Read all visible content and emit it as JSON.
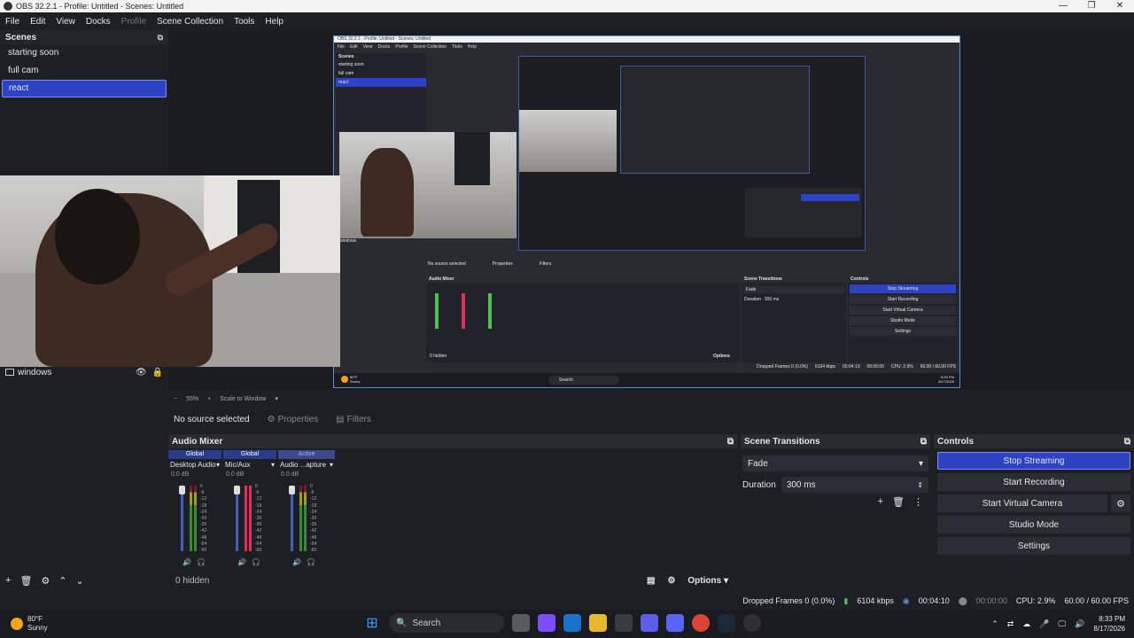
{
  "window": {
    "title": "OBS 32.2.1 - Profile: Untitled - Scenes: Untitled",
    "controls": [
      "—",
      "❐",
      "✕"
    ]
  },
  "menu": {
    "items": [
      "File",
      "Edit",
      "View",
      "Docks",
      "Profile",
      "Scene Collection",
      "Tools",
      "Help"
    ]
  },
  "scenes": {
    "title": "Scenes",
    "items": [
      "starting soon",
      "full cam",
      "react"
    ],
    "selected": "react"
  },
  "sources": {
    "item": "windows"
  },
  "preview": {
    "zoom": "55%",
    "scale": "Scale to Window",
    "nested": {
      "title": "OBS 32.2.1 - Profile: Untitled - Scenes: Untitled",
      "menu": [
        "File",
        "Edit",
        "View",
        "Docks",
        "Profile",
        "Scene Collection",
        "Tools",
        "Help"
      ],
      "scenes_title": "Scenes",
      "scenes": [
        "starting soon",
        "full cam",
        "react"
      ],
      "source": "windows",
      "no_source": "No source selected",
      "properties": "Properties",
      "filters": "Filters",
      "mixer_title": "Audio Mixer",
      "transitions_title": "Scene Transitions",
      "controls_title": "Controls",
      "fade": "Fade",
      "duration": "Duration",
      "duration_val": "300 ms",
      "btns": [
        "Stop Streaming",
        "Start Recording",
        "Start Virtual Camera",
        "Studio Mode",
        "Settings"
      ],
      "hidden": "0 hidden",
      "options": "Options",
      "status": "Dropped Frames 0 (0.0%)",
      "kbps": "6104 kbps",
      "time1": "00:04:10",
      "time2": "00:00:00",
      "cpu": "CPU: 2.9%",
      "fps": "60.00 / 60.00 FPS",
      "weather_temp": "80°F",
      "weather_desc": "Sunny",
      "search": "Search",
      "clock_time": "8:33 PM",
      "clock_date": "8/17/2026"
    }
  },
  "properties_bar": {
    "no_source": "No source selected",
    "properties": "Properties",
    "filters": "Filters"
  },
  "mixer": {
    "title": "Audio Mixer",
    "channels": [
      {
        "badge": "Global",
        "name": "Desktop Audio",
        "db": "0.0 dB",
        "color": "#4ec24e"
      },
      {
        "badge": "Global",
        "name": "Mic/Aux",
        "db": "0.0 dB",
        "color": "#e0305a"
      },
      {
        "badge": "Active",
        "name": "Audio ...apture",
        "db": "0.0 dB",
        "color": "#4ec24e"
      }
    ],
    "scale": [
      "0",
      "-6",
      "-12",
      "-18",
      "-24",
      "-30",
      "-36",
      "-42",
      "-48",
      "-54",
      "-60"
    ],
    "hidden": "0 hidden",
    "options": "Options"
  },
  "transitions": {
    "title": "Scene Transitions",
    "selected": "Fade",
    "duration_label": "Duration",
    "duration_value": "300 ms"
  },
  "controls": {
    "title": "Controls",
    "stop_streaming": "Stop Streaming",
    "start_recording": "Start Recording",
    "start_virtual_camera": "Start Virtual Camera",
    "studio_mode": "Studio Mode",
    "settings": "Settings"
  },
  "status": {
    "dropped": "Dropped Frames 0 (0.0%)",
    "kbps": "6104 kbps",
    "stream_time": "00:04:10",
    "rec_time": "00:00:00",
    "cpu": "CPU: 2.9%",
    "fps": "60.00 / 60.00 FPS"
  },
  "taskbar": {
    "weather_temp": "80°F",
    "weather_desc": "Sunny",
    "search": "Search",
    "time": "8:33 PM",
    "date": "8/17/2026"
  }
}
